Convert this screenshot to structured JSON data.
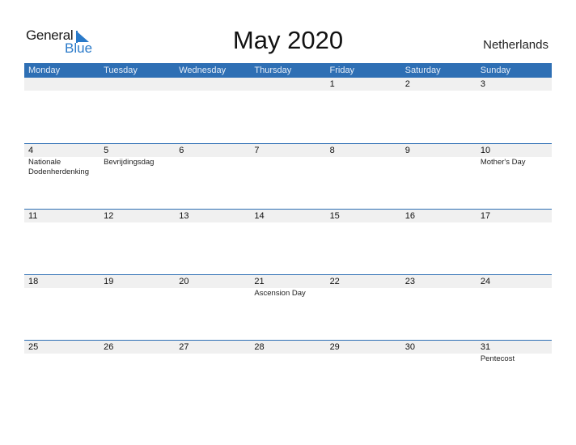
{
  "logo": {
    "line1": "General",
    "line2": "Blue"
  },
  "title": "May 2020",
  "country": "Netherlands",
  "colors": {
    "header_bg": "#2e6fb4",
    "strip_bg": "#f0f0f0",
    "brand_blue": "#2a7ac9"
  },
  "weekdays": [
    "Monday",
    "Tuesday",
    "Wednesday",
    "Thursday",
    "Friday",
    "Saturday",
    "Sunday"
  ],
  "weeks": [
    [
      {
        "day": "",
        "event": ""
      },
      {
        "day": "",
        "event": ""
      },
      {
        "day": "",
        "event": ""
      },
      {
        "day": "",
        "event": ""
      },
      {
        "day": "1",
        "event": ""
      },
      {
        "day": "2",
        "event": ""
      },
      {
        "day": "3",
        "event": ""
      }
    ],
    [
      {
        "day": "4",
        "event": "Nationale Dodenherdenking"
      },
      {
        "day": "5",
        "event": "Bevrijdingsdag"
      },
      {
        "day": "6",
        "event": ""
      },
      {
        "day": "7",
        "event": ""
      },
      {
        "day": "8",
        "event": ""
      },
      {
        "day": "9",
        "event": ""
      },
      {
        "day": "10",
        "event": "Mother's Day"
      }
    ],
    [
      {
        "day": "11",
        "event": ""
      },
      {
        "day": "12",
        "event": ""
      },
      {
        "day": "13",
        "event": ""
      },
      {
        "day": "14",
        "event": ""
      },
      {
        "day": "15",
        "event": ""
      },
      {
        "day": "16",
        "event": ""
      },
      {
        "day": "17",
        "event": ""
      }
    ],
    [
      {
        "day": "18",
        "event": ""
      },
      {
        "day": "19",
        "event": ""
      },
      {
        "day": "20",
        "event": ""
      },
      {
        "day": "21",
        "event": "Ascension Day"
      },
      {
        "day": "22",
        "event": ""
      },
      {
        "day": "23",
        "event": ""
      },
      {
        "day": "24",
        "event": ""
      }
    ],
    [
      {
        "day": "25",
        "event": ""
      },
      {
        "day": "26",
        "event": ""
      },
      {
        "day": "27",
        "event": ""
      },
      {
        "day": "28",
        "event": ""
      },
      {
        "day": "29",
        "event": ""
      },
      {
        "day": "30",
        "event": ""
      },
      {
        "day": "31",
        "event": "Pentecost"
      }
    ]
  ]
}
